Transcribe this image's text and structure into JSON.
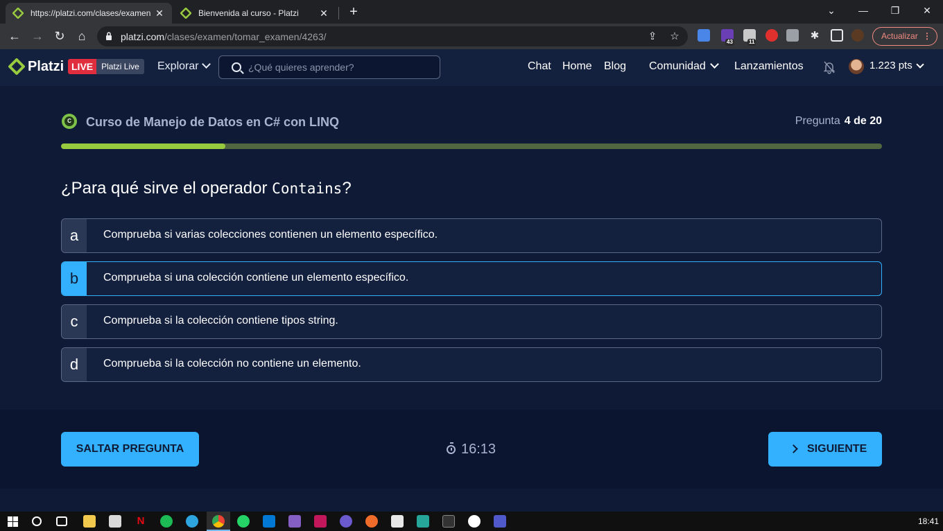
{
  "browser": {
    "tabs": [
      {
        "title": "https://platzi.com/clases/examen",
        "active": true
      },
      {
        "title": "Bienvenida al curso - Platzi",
        "active": false
      }
    ],
    "url_host": "platzi.com",
    "url_path": "/clases/examen/tomar_examen/4263/",
    "extension_badges": [
      "43",
      "11"
    ],
    "update_label": "Actualizar"
  },
  "header": {
    "logo": "Platzi",
    "live_badge": "LIVE",
    "live_label": "Platzi Live",
    "explore": "Explorar",
    "search_placeholder": "¿Qué quieres aprender?",
    "nav": [
      "Chat",
      "Home",
      "Blog",
      "Comunidad",
      "Lanzamientos"
    ],
    "points": "1.223 pts"
  },
  "exam": {
    "course_icon_text": "C",
    "course_title": "Curso de Manejo de Datos en C# con LINQ",
    "question_label": "Pregunta",
    "question_counter": "4 de 20",
    "progress": 0.2,
    "question_prefix": "¿Para qué sirve el operador ",
    "question_code": "Contains",
    "question_suffix": "?",
    "options": [
      {
        "letter": "a",
        "text": "Comprueba si varias colecciones contienen un elemento específico.",
        "selected": false
      },
      {
        "letter": "b",
        "text": "Comprueba si una colección contiene un elemento específico.",
        "selected": true
      },
      {
        "letter": "c",
        "text": "Comprueba si la colección contiene tipos string.",
        "selected": false
      },
      {
        "letter": "d",
        "text": "Comprueba si la colección no contiene un elemento.",
        "selected": false
      }
    ]
  },
  "footer": {
    "skip_label": "SALTAR PREGUNTA",
    "timer": "16:13",
    "next_label": "SIGUIENTE"
  },
  "taskbar": {
    "clock": "18:41"
  },
  "colors": {
    "accent": "#33b1ff",
    "progress_fill": "#98ca3f",
    "background": "#0f1b36",
    "live_red": "#e02e3e"
  }
}
